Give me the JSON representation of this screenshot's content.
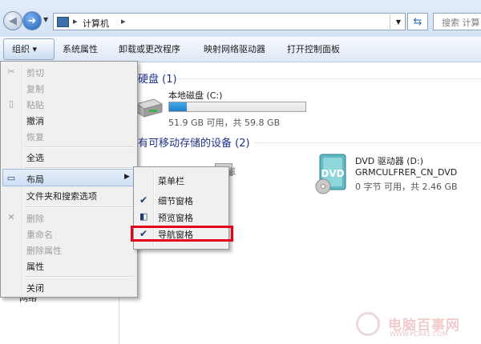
{
  "address_bar": {
    "path": "计算机",
    "search_placeholder": "搜索 计算"
  },
  "toolbar": {
    "organize": "组织 ▾",
    "items": [
      "系统属性",
      "卸载或更改程序",
      "映射网络驱动器",
      "打开控制面板"
    ]
  },
  "groups": {
    "hard_disks": "硬盘 (1)",
    "removable": "有可移动存储的设备 (2)"
  },
  "drive_c": {
    "name": "本地磁盘 (C:)",
    "used_fraction": 0.13,
    "free_text": "51.9 GB 可用，共 59.8 GB"
  },
  "drive_d": {
    "name": "DVD 驱动器 (D:)",
    "label": "GRMCULFRER_CN_DVD",
    "free_text": "0 字节 可用，共 2.46 GB"
  },
  "removable_partial": "可移动磁",
  "nav_bottom": "网络",
  "organize_menu": {
    "items": [
      {
        "label": "剪切",
        "icon": "scissors-icon",
        "enabled": false
      },
      {
        "label": "复制",
        "icon": "copy-icon",
        "enabled": false
      },
      {
        "label": "粘贴",
        "icon": "paste-icon",
        "enabled": false
      },
      {
        "label": "撤消",
        "enabled": true
      },
      {
        "label": "恢复",
        "enabled": false
      },
      {
        "label": "全选",
        "enabled": true
      },
      {
        "label": "布局",
        "icon": "layout-icon",
        "enabled": true,
        "has_submenu": true
      },
      {
        "label": "文件夹和搜索选项",
        "enabled": true
      },
      {
        "label": "删除",
        "icon": "delete-icon",
        "enabled": false
      },
      {
        "label": "重命名",
        "enabled": false
      },
      {
        "label": "删除属性",
        "enabled": false
      },
      {
        "label": "属性",
        "enabled": true
      },
      {
        "label": "关闭",
        "enabled": true
      }
    ]
  },
  "layout_submenu": {
    "items": [
      {
        "label": "菜单栏",
        "checked": false
      },
      {
        "label": "细节窗格",
        "checked": true
      },
      {
        "label": "预览窗格",
        "checked": false,
        "icon": "preview-pane-icon"
      },
      {
        "label": "导航窗格",
        "checked": true,
        "highlighted": true
      }
    ]
  },
  "watermark": {
    "text": "电脑百事网",
    "url": "WWW.PC841.COM"
  },
  "colors": {
    "highlight_box": "#e3001b",
    "group_header": "#1e3287",
    "drive_fill": "#1f7fcb"
  }
}
